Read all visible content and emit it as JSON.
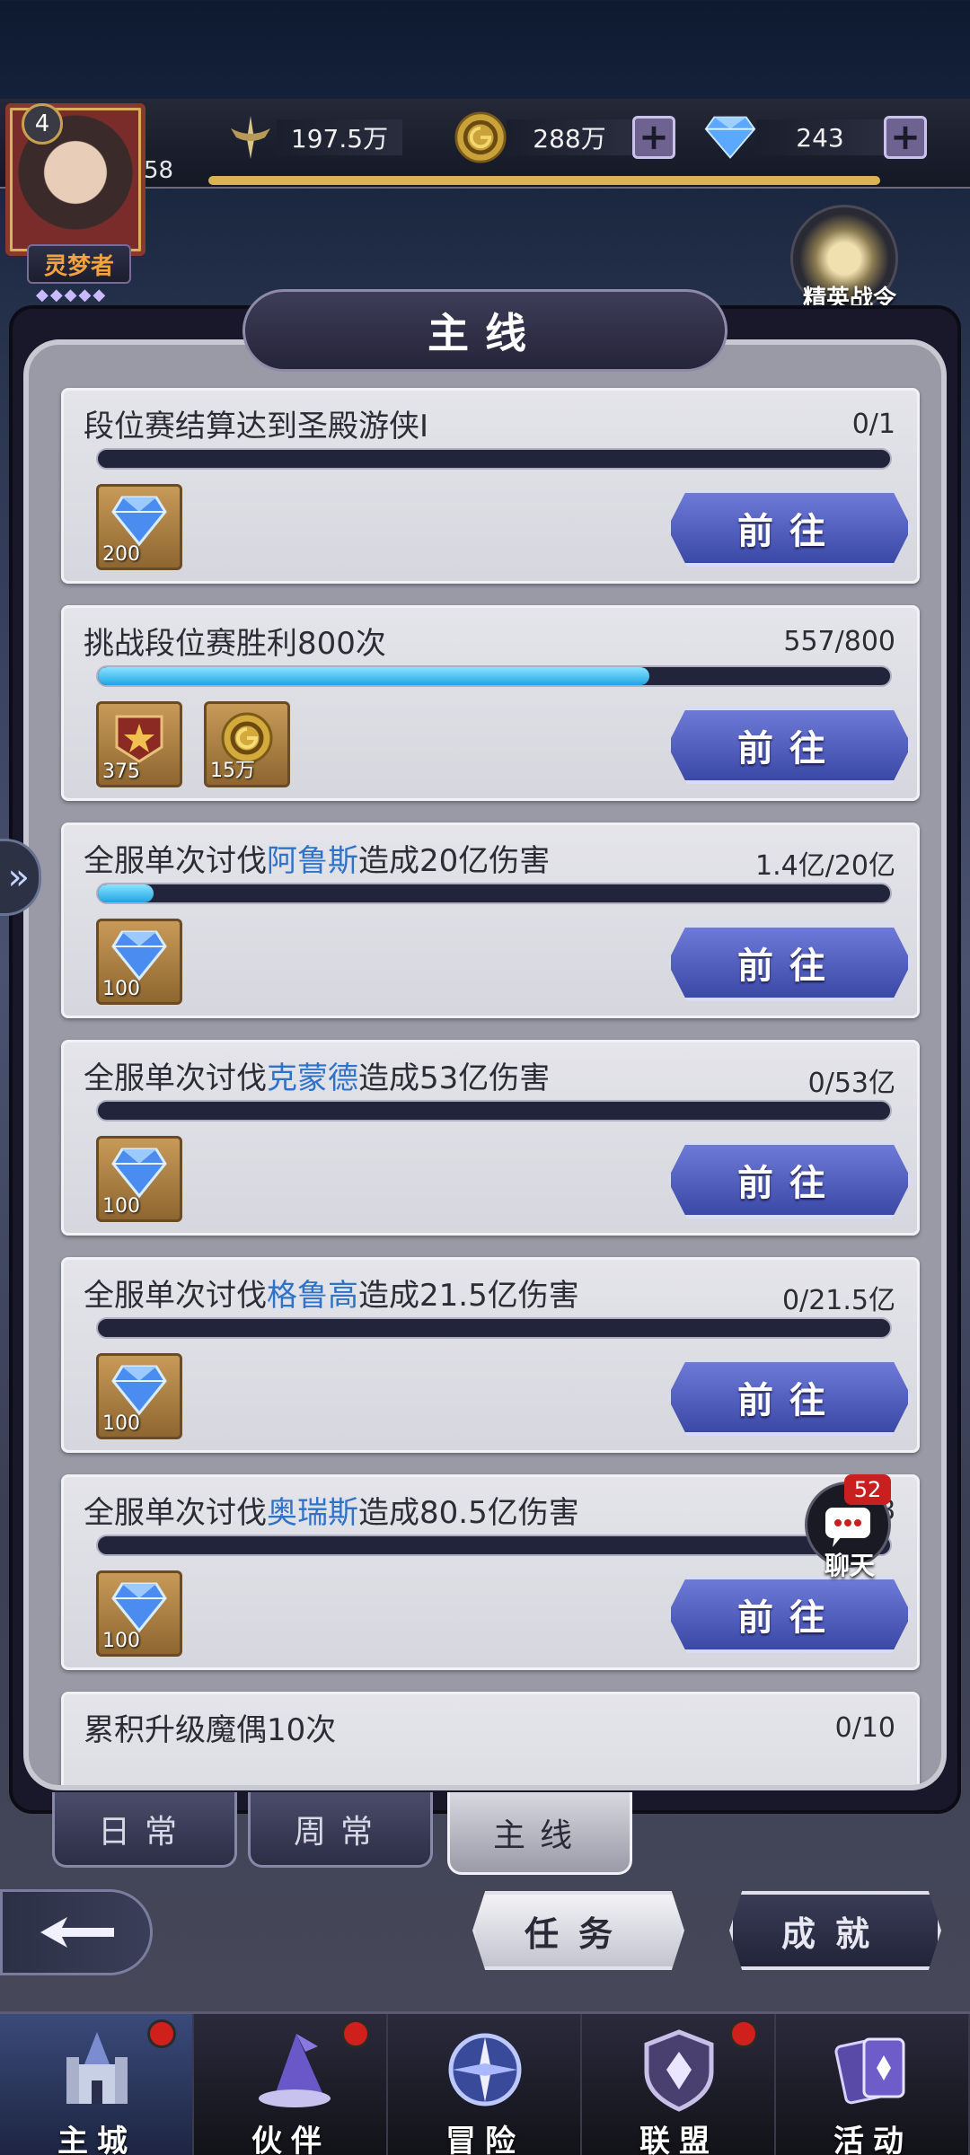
{
  "player": {
    "level_badge": "4",
    "level": "58",
    "title": "灵梦者",
    "title_stars": "◆◆◆◆◆"
  },
  "resources": {
    "power": "197.5万",
    "gold": "288万",
    "diamond": "243"
  },
  "elite_pass": {
    "label": "精英战令"
  },
  "panel_title": "主线",
  "tasks": [
    {
      "title_pre": "段位赛结算达到圣殿游侠Ⅰ",
      "title_highlight": "",
      "title_post": "",
      "progress": "0/1",
      "fill": 0,
      "rewards": [
        {
          "icon": "diamond-icon",
          "count": "200"
        }
      ],
      "button": "前往"
    },
    {
      "title_pre": "挑战段位赛胜利800次",
      "title_highlight": "",
      "title_post": "",
      "progress": "557/800",
      "fill": 0.696,
      "rewards": [
        {
          "icon": "rank-badge-icon",
          "count": "375"
        },
        {
          "icon": "gold-coin-icon",
          "count": "15万"
        }
      ],
      "button": "前往"
    },
    {
      "title_pre": "全服单次讨伐",
      "title_highlight": "阿鲁斯",
      "title_post": "造成20亿伤害",
      "progress": "1.4亿/20亿",
      "fill": 0.07,
      "rewards": [
        {
          "icon": "diamond-icon",
          "count": "100"
        }
      ],
      "button": "前往"
    },
    {
      "title_pre": "全服单次讨伐",
      "title_highlight": "克蒙德",
      "title_post": "造成53亿伤害",
      "progress": "0/53亿",
      "fill": 0,
      "rewards": [
        {
          "icon": "diamond-icon",
          "count": "100"
        }
      ],
      "button": "前往"
    },
    {
      "title_pre": "全服单次讨伐",
      "title_highlight": "格鲁高",
      "title_post": "造成21.5亿伤害",
      "progress": "0/21.5亿",
      "fill": 0,
      "rewards": [
        {
          "icon": "diamond-icon",
          "count": "100"
        }
      ],
      "button": "前往"
    },
    {
      "title_pre": "全服单次讨伐",
      "title_highlight": "奥瑞斯",
      "title_post": "造成80.5亿伤害",
      "progress": "0/8",
      "fill": 0,
      "rewards": [
        {
          "icon": "diamond-icon",
          "count": "100"
        }
      ],
      "button": "前往"
    },
    {
      "title_pre": "累积升级魔偶10次",
      "title_highlight": "",
      "title_post": "",
      "progress": "0/10",
      "fill": 0,
      "rewards": [],
      "button": ""
    }
  ],
  "chat": {
    "badge": "52",
    "label": "聊天"
  },
  "sub_tabs": [
    "日常",
    "周常",
    "主线"
  ],
  "sub_tab_active": "主线",
  "actions": {
    "task": "任务",
    "achievement": "成就"
  },
  "nav": [
    {
      "label": "主城",
      "icon": "castle-icon",
      "dot": true,
      "active": true
    },
    {
      "label": "伙伴",
      "icon": "wizard-hat-icon",
      "dot": true,
      "active": false
    },
    {
      "label": "冒险",
      "icon": "compass-icon",
      "dot": false,
      "active": false
    },
    {
      "label": "联盟",
      "icon": "shield-icon",
      "dot": true,
      "active": false
    },
    {
      "label": "活动",
      "icon": "cards-icon",
      "dot": false,
      "active": false
    }
  ]
}
